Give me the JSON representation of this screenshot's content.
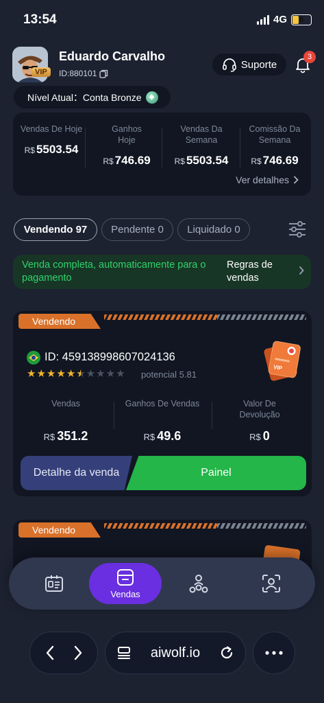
{
  "status_bar": {
    "time": "13:54",
    "network": "4G",
    "battery": "8"
  },
  "user": {
    "name": "Eduardo Carvalho",
    "id": "ID:880101",
    "vip": "VIP"
  },
  "header": {
    "support_label": "Suporte",
    "notification_count": "3"
  },
  "level": {
    "label": "Nível Atual：Conta Bronze"
  },
  "stats": [
    {
      "label": "Vendas De Hoje",
      "currency": "R$",
      "value": "5503.54"
    },
    {
      "label": "Ganhos Hoje",
      "currency": "R$",
      "value": "746.69"
    },
    {
      "label": "Vendas Da Semana",
      "currency": "R$",
      "value": "5503.54"
    },
    {
      "label": "Comissão Da Semana",
      "currency": "R$",
      "value": "746.69"
    }
  ],
  "stats_details": "Ver detalhes",
  "tabs": [
    {
      "label": "Vendendo 97",
      "active": true
    },
    {
      "label": "Pendente 0",
      "active": false
    },
    {
      "label": "Liquidado 0",
      "active": false
    }
  ],
  "banner": {
    "text": "Venda completa, automaticamente para o pagamento",
    "rule": "Regras de vendas"
  },
  "order": {
    "status": "Vendendo",
    "id": "ID: 459138998607024136",
    "rating": 5.81,
    "potential": "potencial 5.81",
    "metrics": [
      {
        "label": "Vendas",
        "currency": "R$",
        "value": "351.2"
      },
      {
        "label": "Ganhos De Vendas",
        "currency": "R$",
        "value": "49.6"
      },
      {
        "label": "Valor De Devolução",
        "currency": "R$",
        "value": "0"
      }
    ],
    "detail_button": "Detalhe da venda",
    "panel_button": "Painel"
  },
  "order2": {
    "status": "Vendendo"
  },
  "bottom_nav": {
    "active_label": "Vendas"
  },
  "browser": {
    "url": "aiwolf.io"
  },
  "colors": {
    "accent_purple": "#6a2fe0",
    "green": "#24b648",
    "orange": "#d9712a",
    "background": "#1d2231"
  }
}
